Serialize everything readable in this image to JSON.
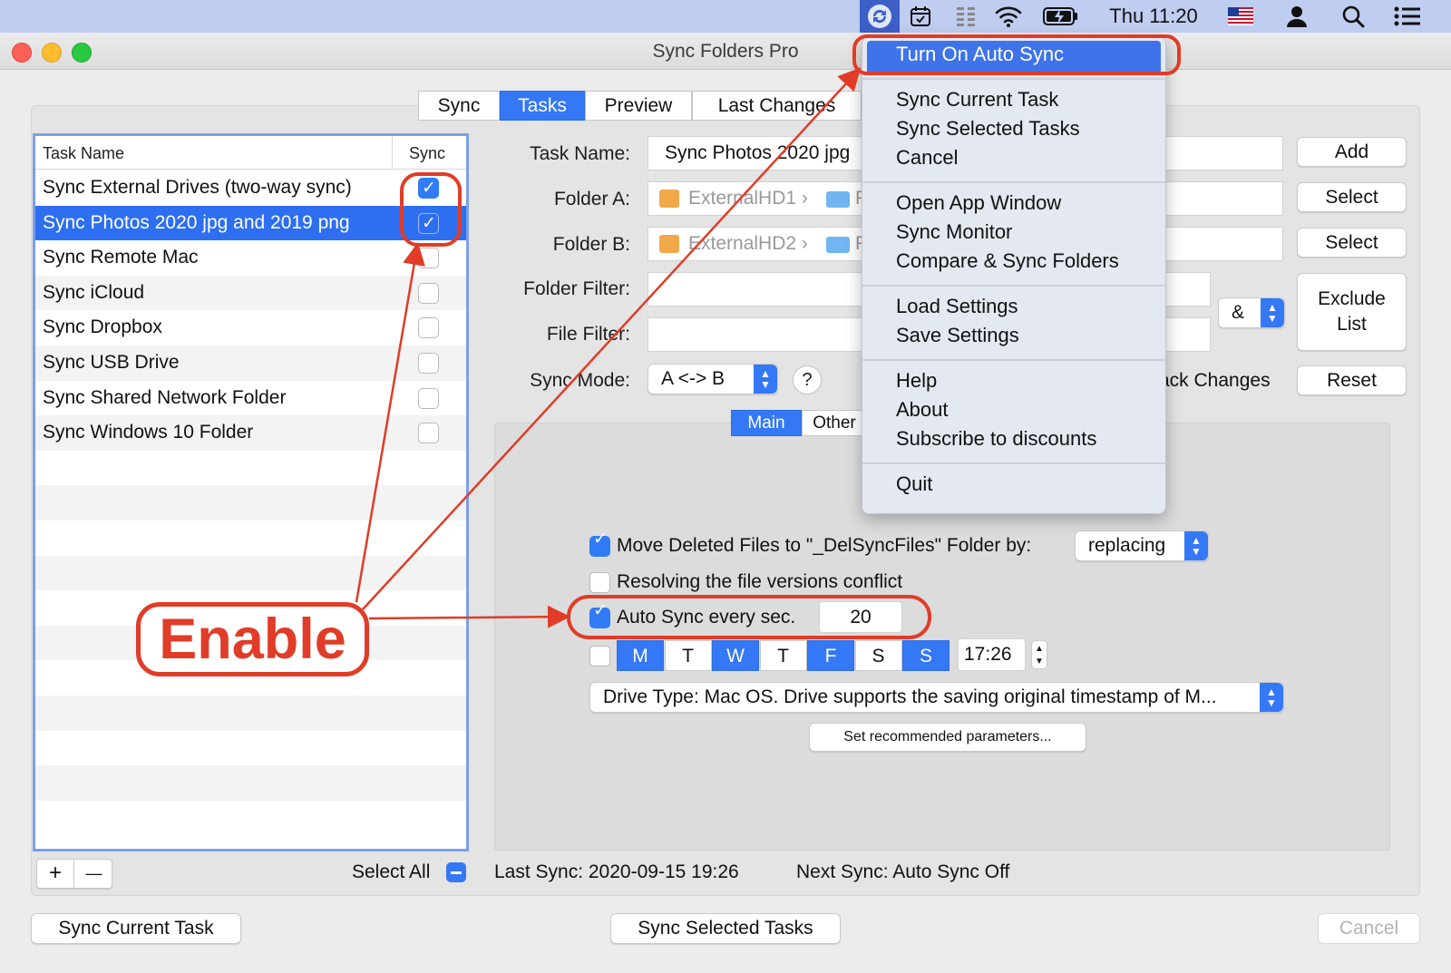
{
  "menubar": {
    "clock": "Thu 11:20"
  },
  "window": {
    "title": "Sync Folders Pro"
  },
  "tabs": [
    "Sync",
    "Tasks",
    "Preview",
    "Last Changes"
  ],
  "table": {
    "headers": [
      "Task Name",
      "Sync"
    ],
    "rows": [
      {
        "name": "Sync External Drives (two-way sync)",
        "checked": true
      },
      {
        "name": "Sync Photos 2020 jpg and 2019 png",
        "checked": true
      },
      {
        "name": "Sync Remote Mac",
        "checked": false
      },
      {
        "name": "Sync iCloud",
        "checked": false
      },
      {
        "name": "Sync Dropbox",
        "checked": false
      },
      {
        "name": "Sync USB Drive",
        "checked": false
      },
      {
        "name": "Sync Shared Network Folder",
        "checked": false
      },
      {
        "name": "Sync Windows 10 Folder",
        "checked": false
      }
    ],
    "select_all": "Select All"
  },
  "form": {
    "task_name_label": "Task Name:",
    "task_name_value": "Sync Photos 2020 jpg",
    "folder_a_label": "Folder A:",
    "folder_a_value": "ExternalHD1 ›",
    "folder_a_sub": "P",
    "folder_b_label": "Folder B:",
    "folder_b_value": "ExternalHD2 ›",
    "folder_b_sub": "P",
    "folder_filter_label": "Folder Filter:",
    "file_filter_label": "File Filter:",
    "sync_mode_label": "Sync Mode:",
    "sync_mode_value": "A <-> B",
    "help": "?",
    "amp": "&",
    "track_changes": "ack Changes"
  },
  "buttons": {
    "add": "Add",
    "select_a": "Select",
    "select_b": "Select",
    "exclude_1": "Exclude",
    "exclude_2": "List",
    "reset": "Reset",
    "plus": "+",
    "minus": "—",
    "sync_current": "Sync Current Task",
    "sync_selected": "Sync Selected Tasks",
    "cancel": "Cancel",
    "set_recommended": "Set recommended parameters..."
  },
  "subtabs": [
    "Main",
    "Other"
  ],
  "options": {
    "move_deleted": "Move Deleted Files to \"_DelSyncFiles\" Folder by:",
    "move_deleted_mode": "replacing",
    "resolving": "Resolving the file versions conflict",
    "auto_sync": "Auto Sync every sec.",
    "auto_sync_value": "20",
    "days": [
      {
        "d": "M",
        "on": true
      },
      {
        "d": "T",
        "on": false
      },
      {
        "d": "W",
        "on": true
      },
      {
        "d": "T",
        "on": false
      },
      {
        "d": "F",
        "on": true
      },
      {
        "d": "S",
        "on": false
      },
      {
        "d": "S",
        "on": true
      }
    ],
    "time": "17:26",
    "drive_type": "Drive Type: Mac OS. Drive supports the saving original timestamp of M..."
  },
  "status": {
    "last_sync": "Last Sync: 2020-09-15 19:26",
    "next_sync": "Next Sync: Auto Sync Off"
  },
  "menu": {
    "items": [
      "Turn On Auto Sync",
      "Sync Current Task",
      "Sync Selected Tasks",
      "Cancel",
      "Open App Window",
      "Sync Monitor",
      "Compare & Sync Folders",
      "Load Settings",
      "Save Settings",
      "Help",
      "About",
      "Subscribe to discounts",
      "Quit"
    ]
  },
  "annotation": {
    "label": "Enable",
    "color": "#e03c28"
  },
  "colors": {
    "accent": "#3478f6",
    "annotation": "#e03c28"
  }
}
